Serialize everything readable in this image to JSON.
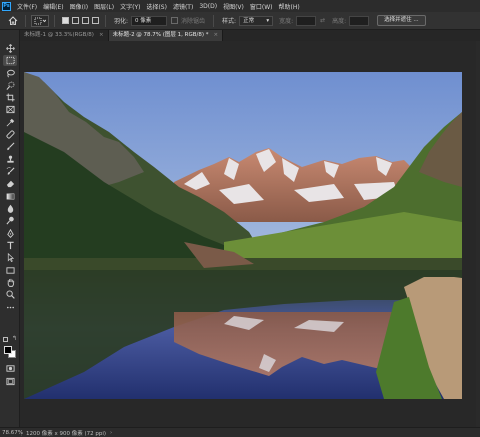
{
  "app": {
    "logo": "Ps"
  },
  "menu": [
    "文件(F)",
    "编辑(E)",
    "图像(I)",
    "图层(L)",
    "文字(Y)",
    "选择(S)",
    "滤镜(T)",
    "3D(D)",
    "视图(V)",
    "窗口(W)",
    "帮助(H)"
  ],
  "options": {
    "feather_label": "羽化:",
    "feather_value": "0 像素",
    "antialias_label": "消除锯齿",
    "style_label": "样式:",
    "style_value": "正常",
    "width_label": "宽度:",
    "height_label": "高度:",
    "select_mask_label": "选择并遮住 ..."
  },
  "tabs": [
    {
      "label": "未标题-1 @ 33.3%(RGB/8)",
      "close": "×"
    },
    {
      "label": "未标题-2 @ 78.7% (图层 1, RGB/8) *",
      "close": "×"
    }
  ],
  "status": {
    "zoom": "78.67%",
    "info": "1200 像素 x 900 像素 (72 ppi)"
  },
  "colors": {
    "foreground": "#000000",
    "background": "#ffffff",
    "accent": "#31a8ff"
  },
  "tools": [
    "move-tool",
    "marquee-tool",
    "lasso-tool",
    "quick-select-tool",
    "crop-tool",
    "frame-tool",
    "eyedropper-tool",
    "healing-brush-tool",
    "brush-tool",
    "clone-stamp-tool",
    "history-brush-tool",
    "eraser-tool",
    "gradient-tool",
    "blur-tool",
    "dodge-tool",
    "pen-tool",
    "type-tool",
    "path-select-tool",
    "rectangle-tool",
    "hand-tool",
    "zoom-tool",
    "more-tools"
  ]
}
